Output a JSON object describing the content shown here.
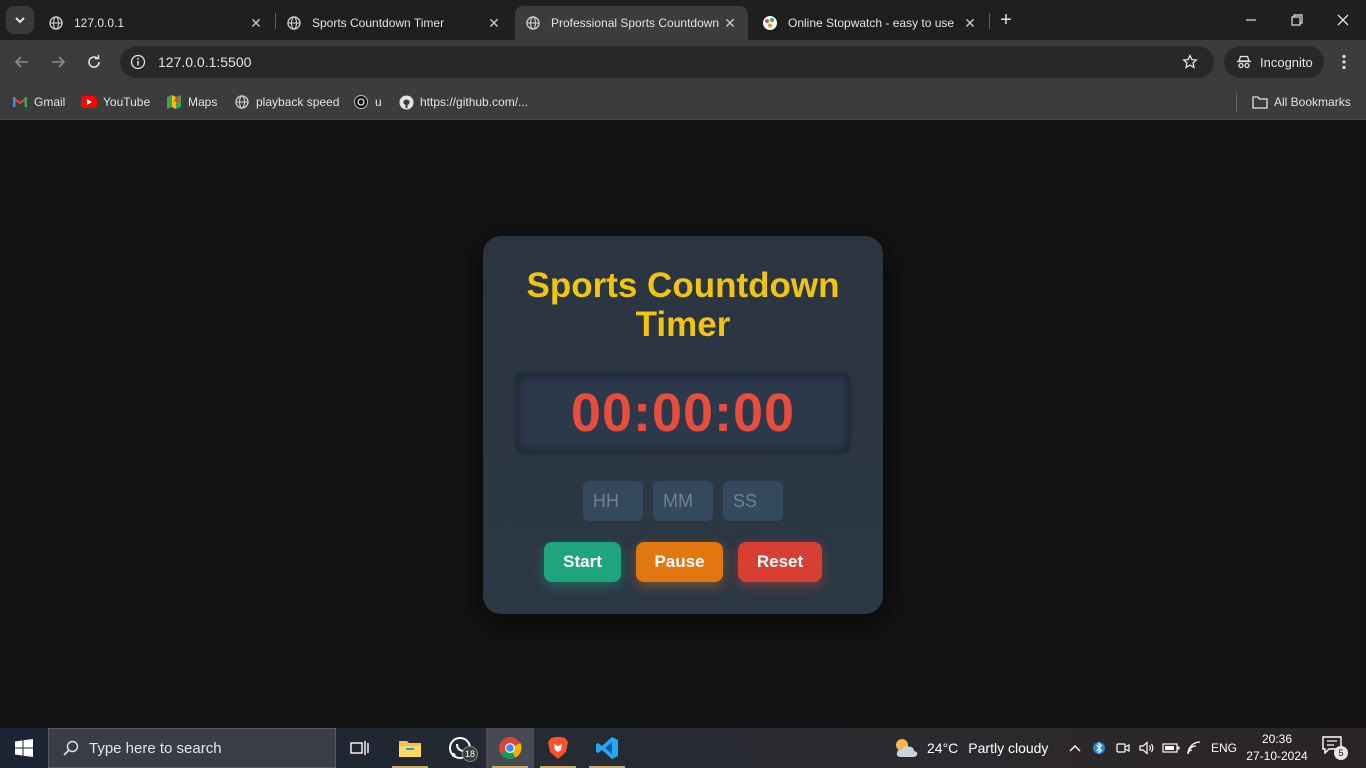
{
  "browser": {
    "tabs": [
      {
        "title": "127.0.0.1",
        "active": false
      },
      {
        "title": "Sports Countdown Timer",
        "active": false
      },
      {
        "title": "Professional Sports Countdown",
        "active": true
      },
      {
        "title": "Online Stopwatch - easy to use",
        "active": false
      }
    ],
    "close_glyph": "✕",
    "new_tab_glyph": "+",
    "address": "127.0.0.1:5500",
    "profile_label": "Incognito",
    "bookmarks": [
      {
        "label": "Gmail",
        "icon": "gmail-icon"
      },
      {
        "label": "YouTube",
        "icon": "youtube-icon"
      },
      {
        "label": "Maps",
        "icon": "maps-icon"
      },
      {
        "label": "playback speed",
        "icon": "globe-icon"
      },
      {
        "label": "u",
        "icon": "openai-icon"
      },
      {
        "label": "https://github.com/...",
        "icon": "github-icon"
      }
    ],
    "all_bookmarks_label": "All Bookmarks"
  },
  "app": {
    "title": "Sports Countdown Timer",
    "display": "00:00:00",
    "inputs": {
      "hours_placeholder": "HH",
      "minutes_placeholder": "MM",
      "seconds_placeholder": "SS"
    },
    "buttons": {
      "start": "Start",
      "pause": "Pause",
      "reset": "Reset"
    },
    "colors": {
      "title": "#f1c40f",
      "display": "#e74c3c",
      "start": "#1fa57c",
      "pause": "#e2760f",
      "reset": "#d83f33"
    }
  },
  "taskbar": {
    "search_placeholder": "Type here to search",
    "whatsapp_badge": "18",
    "weather_temp": "24°C",
    "weather_desc": "Partly cloudy",
    "language": "ENG",
    "time": "20:36",
    "date": "27-10-2024",
    "notification_count": "5"
  }
}
